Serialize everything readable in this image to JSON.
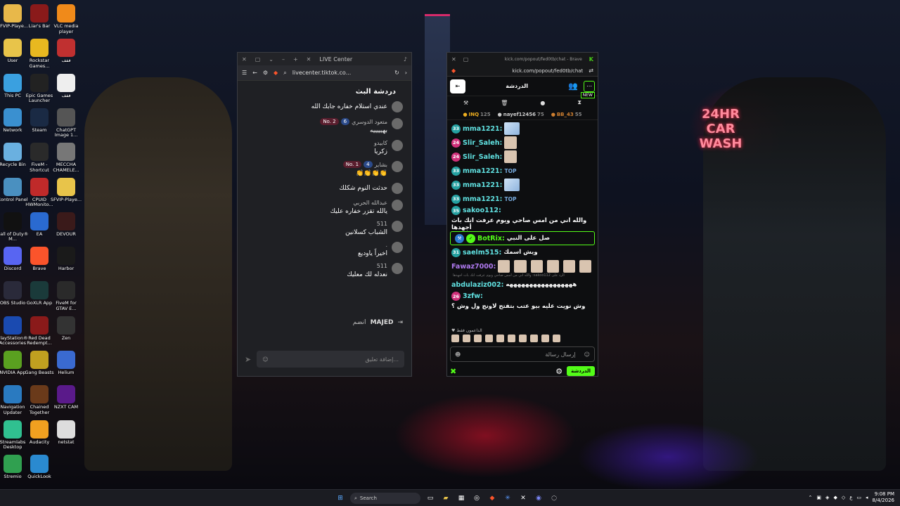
{
  "desktop_icons": [
    [
      {
        "label": "SFVIP-Playe...",
        "icon": "folder-icon",
        "color": "#e8b84a"
      },
      {
        "label": "Liar's Bar",
        "icon": "liars-bar-icon",
        "color": "#8a1a1a"
      },
      {
        "label": "VLC media player",
        "icon": "vlc-icon",
        "color": "#f08a1a"
      }
    ],
    [
      {
        "label": "User",
        "icon": "folder-icon",
        "color": "#e8c44a"
      },
      {
        "label": "Rockstar Games...",
        "icon": "rockstar-icon",
        "color": "#e8b820"
      },
      {
        "label": "ففف",
        "icon": "app-icon",
        "color": "#c03030"
      }
    ],
    [
      {
        "label": "This PC",
        "icon": "pc-icon",
        "color": "#3aa0e0"
      },
      {
        "label": "Epic Games Launcher",
        "icon": "epic-icon",
        "color": "#222222"
      },
      {
        "label": "ففف",
        "icon": "media-icon",
        "color": "#eeeeee"
      }
    ],
    [
      {
        "label": "Network",
        "icon": "network-icon",
        "color": "#3a90d0"
      },
      {
        "label": "Steam",
        "icon": "steam-icon",
        "color": "#1a2a44"
      },
      {
        "label": "ChatGPT Image 1...",
        "icon": "image-icon",
        "color": "#555555"
      }
    ],
    [
      {
        "label": "Recycle Bin",
        "icon": "recycle-bin-icon",
        "color": "#6ab0e0"
      },
      {
        "label": "FiveM - Shortcut",
        "icon": "fivem-icon",
        "color": "#2a2a2a"
      },
      {
        "label": "MECCHA CHAMELE...",
        "icon": "image-icon",
        "color": "#777777"
      }
    ],
    [
      {
        "label": "Control Panel",
        "icon": "control-panel-icon",
        "color": "#4a90c0"
      },
      {
        "label": "CPUID HWMonito...",
        "icon": "cpuid-icon",
        "color": "#c02a2a"
      },
      {
        "label": "SFVIP-Playe...",
        "icon": "folder-icon",
        "color": "#e8c44a"
      }
    ],
    [
      {
        "label": "Call of Duty® M...",
        "icon": "cod-icon",
        "color": "#111111"
      },
      {
        "label": "EA",
        "icon": "ea-icon",
        "color": "#2a6ad0"
      },
      {
        "label": "DEVOUR",
        "icon": "devour-icon",
        "color": "#3a1a1a"
      }
    ],
    [
      {
        "label": "Discord",
        "icon": "discord-icon",
        "color": "#5865f2"
      },
      {
        "label": "Brave",
        "icon": "brave-icon",
        "color": "#fb542b"
      },
      {
        "label": "Harbor",
        "icon": "harbor-icon",
        "color": "#1a1a1a"
      }
    ],
    [
      {
        "label": "OBS Studio",
        "icon": "obs-icon",
        "color": "#2a2a3a"
      },
      {
        "label": "GoXLR App",
        "icon": "goxlr-icon",
        "color": "#1a3a3a"
      },
      {
        "label": "FiveM for GTAV E...",
        "icon": "fivem-icon",
        "color": "#2a2a2a"
      }
    ],
    [
      {
        "label": "PlayStation® Accessories",
        "icon": "playstation-icon",
        "color": "#1a4ab0"
      },
      {
        "label": "Red Dead Redempt...",
        "icon": "rdr-icon",
        "color": "#8a1a1a"
      },
      {
        "label": "Zen",
        "icon": "zen-icon",
        "color": "#333333"
      }
    ],
    [
      {
        "label": "NVIDIA App",
        "icon": "nvidia-icon",
        "color": "#5aa020"
      },
      {
        "label": "Gang Beasts",
        "icon": "gang-beasts-icon",
        "color": "#c0a020"
      },
      {
        "label": "Helium",
        "icon": "helium-icon",
        "color": "#3a6ad0"
      }
    ],
    [
      {
        "label": "Navigation Updater",
        "icon": "navigation-icon",
        "color": "#2a7ac0"
      },
      {
        "label": "Chained Together",
        "icon": "chained-icon",
        "color": "#6a3a1a"
      },
      {
        "label": "NZXT CAM",
        "icon": "nzxt-icon",
        "color": "#5a1a8a"
      }
    ],
    [
      {
        "label": "Streamlabs Desktop",
        "icon": "streamlabs-icon",
        "color": "#30c090"
      },
      {
        "label": "Audacity",
        "icon": "audacity-icon",
        "color": "#f0a020"
      },
      {
        "label": "netstat",
        "icon": "file-icon",
        "color": "#dddddd"
      }
    ],
    [
      {
        "label": "Stremio",
        "icon": "stremio-icon",
        "color": "#30a050"
      },
      {
        "label": "QuickLook",
        "icon": "quicklook-icon",
        "color": "#2a8ad0"
      }
    ]
  ],
  "neon_sign": [
    "24HR",
    "CAR",
    "WASH"
  ],
  "tiktok_window": {
    "tab_title": "LIVE Center",
    "url": "livecenter.tiktok.co...",
    "heading": "دردشة البث",
    "messages": [
      {
        "name": "",
        "text": "عندي استلام خفاره جابك الله",
        "badges": []
      },
      {
        "name": "متعود الدوسري",
        "text": "بهيييييه",
        "badges": [
          "No. 2",
          "6"
        ]
      },
      {
        "name": "كابيدو",
        "text": "زكريا",
        "badges": []
      },
      {
        "name": "بشاير",
        "text": "👏👏👏👏",
        "badges": [
          "No. 1",
          "4"
        ]
      },
      {
        "name": "",
        "text": "حدثت النوم شكلك",
        "badges": []
      },
      {
        "name": "عبدالله الحربي",
        "text": "يالله تقزر خفاره عليك",
        "badges": []
      },
      {
        "name": "511",
        "text": "الشباب كسلانين",
        "badges": []
      },
      {
        "name": ".",
        "text": "اخيراً ياوديع",
        "badges": []
      },
      {
        "name": "511",
        "text": "نعدله لك معليك",
        "badges": []
      }
    ],
    "join_line": {
      "name": "MAJED",
      "text": "انضم"
    },
    "comment_placeholder": "إضافة تعليق..."
  },
  "kick_window": {
    "titlebar": "kick.com/popout/fed0tb/chat - Brave",
    "url": "kick.com/popout/fed0tb/chat",
    "chat_tab": "الدردشة",
    "new_badge": "NEW",
    "leaderboard": [
      {
        "name": "INQ",
        "value": "125",
        "color": "#f0b020"
      },
      {
        "name": "nayef12456",
        "value": "75",
        "color": "#cccccc"
      },
      {
        "name": "BB_43",
        "value": "55",
        "color": "#d08030"
      }
    ],
    "messages": [
      {
        "lv": "33",
        "lv_color": "#24a0a0",
        "user": "mma1221:",
        "user_color": "#60e0e0",
        "text": "",
        "emote": "image"
      },
      {
        "lv": "24",
        "lv_color": "#d0307a",
        "user": "Slir_Saleh:",
        "user_color": "#60e0e0",
        "text": "",
        "emote": "face"
      },
      {
        "lv": "24",
        "lv_color": "#d0307a",
        "user": "Slir_Saleh:",
        "user_color": "#60e0e0",
        "text": "",
        "emote": "face"
      },
      {
        "lv": "33",
        "lv_color": "#24a0a0",
        "user": "mma1221:",
        "user_color": "#60e0e0",
        "text": "TOP",
        "emote": ""
      },
      {
        "lv": "33",
        "lv_color": "#24a0a0",
        "user": "mma1221:",
        "user_color": "#60e0e0",
        "text": "",
        "emote": "image"
      },
      {
        "lv": "33",
        "lv_color": "#24a0a0",
        "user": "mma1221:",
        "user_color": "#60e0e0",
        "text": "TOP",
        "emote": ""
      },
      {
        "lv": "35",
        "lv_color": "#24a0a0",
        "user": "sakoo112:",
        "user_color": "#60e0e0",
        "text": "والله اني من امس صاحي ويوم عرفت انك باث أجهدها",
        "emote": ""
      },
      {
        "lv": "",
        "lv_color": "#2a7ad0",
        "user": "BotRix:",
        "user_color": "#53fc18",
        "text": "صل على النبي",
        "emote": "",
        "highlight": true
      },
      {
        "lv": "31",
        "lv_color": "#24a0a0",
        "user": "saelm515:",
        "user_color": "#60e0e0",
        "text": "ويش اسمك",
        "emote": ""
      },
      {
        "lv": "",
        "lv_color": "#8a5ad0",
        "user": "Fawaz7000:",
        "user_color": "#b07af0",
        "text": "",
        "emote": "faces"
      },
      {
        "lv": "",
        "lv_color": "#24a0a0",
        "user": "abdulaziz002:",
        "user_color": "#60e0e0",
        "text": "هههههههههههههههههه",
        "emote": "",
        "reply": "والله اني من امس صاحي ويوم عرفت انك باث أجهدها :sakoo112 الرد على"
      },
      {
        "lv": "26",
        "lv_color": "#d0307a",
        "user": "3zfw:",
        "user_color": "#60e0e0",
        "text": "وش نويت عليه بيو عتب بتفتح لاونج ول وش ؟",
        "emote": ""
      }
    ],
    "supporters_label": "الداعمون فقط",
    "input_placeholder": "إرسال رسالة",
    "send_label": "الدردشة"
  },
  "taskbar": {
    "search_placeholder": "Search",
    "time": "9:08 PM",
    "date": "8/4/2026"
  }
}
